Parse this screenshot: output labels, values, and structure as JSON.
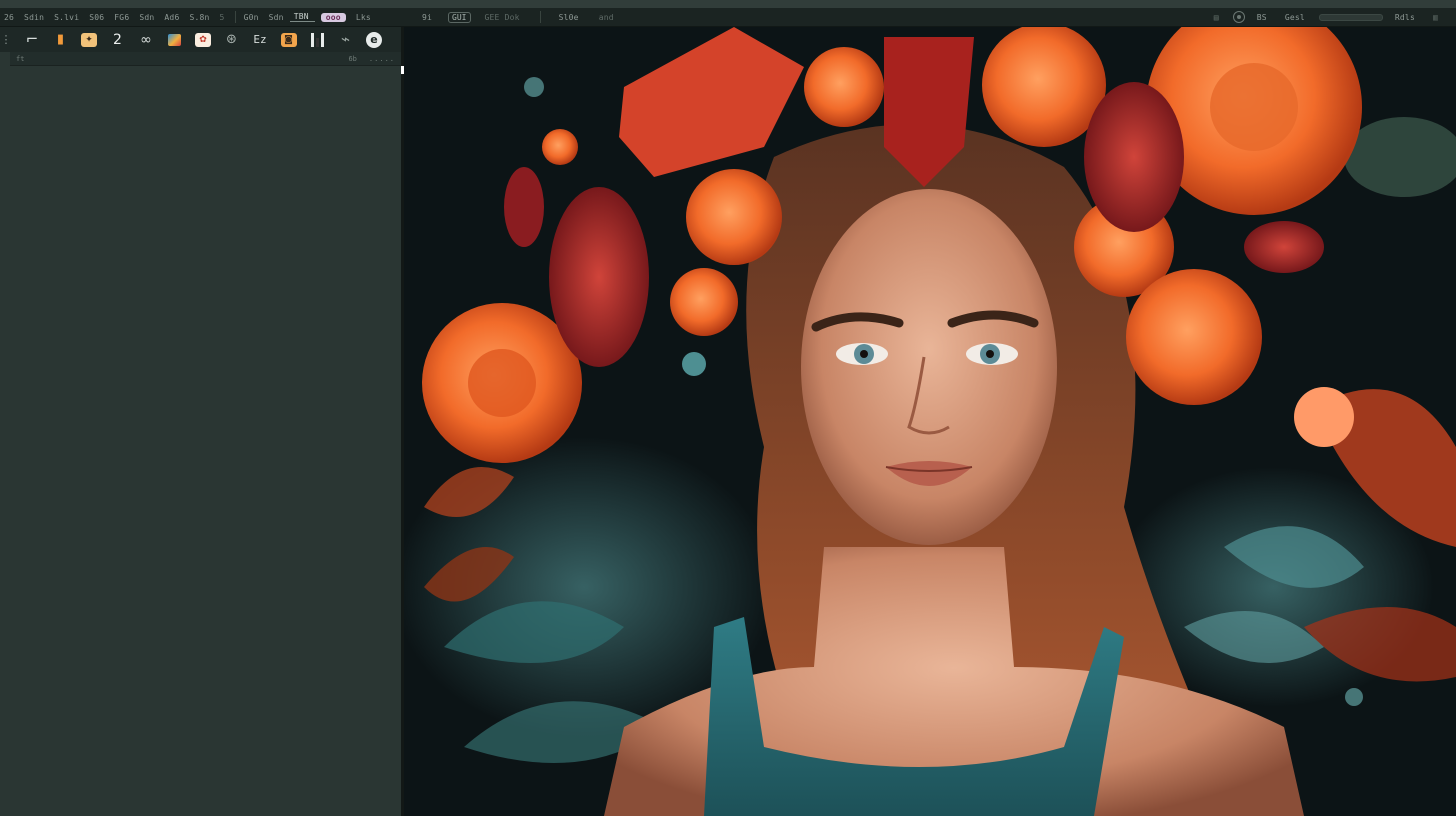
{
  "menubar": {
    "left_items": [
      {
        "label": "26"
      },
      {
        "label": "Sdin"
      },
      {
        "label": "S.lvi"
      },
      {
        "label": "S06"
      },
      {
        "label": "FG6"
      },
      {
        "label": "Sdn"
      },
      {
        "label": "Ad6"
      },
      {
        "label": "S.8n"
      },
      {
        "label": "5"
      },
      {
        "label": "G0n"
      },
      {
        "label": "Sdn"
      },
      {
        "label": "TBN"
      },
      {
        "label": "ooo"
      },
      {
        "label": "Lks"
      }
    ],
    "center_items": [
      {
        "label": "9i"
      },
      {
        "label": "GUI"
      },
      {
        "label": "GEE Dok"
      },
      {
        "label": "Sl0e"
      },
      {
        "label": "and"
      }
    ],
    "right_items": [
      {
        "label": "BS"
      },
      {
        "label": "Gesl"
      },
      {
        "label": "Rdls"
      }
    ]
  },
  "toolbar": {
    "tools": [
      {
        "name": "tool-handle",
        "glyph": "⋮"
      },
      {
        "name": "tool-crop",
        "glyph": "⌐"
      },
      {
        "name": "tool-marker",
        "glyph": "▮"
      },
      {
        "name": "tool-stamp",
        "glyph": "✦"
      },
      {
        "name": "tool-number",
        "glyph": "2"
      },
      {
        "name": "tool-link",
        "glyph": "∞"
      },
      {
        "name": "tool-image",
        "glyph": ""
      },
      {
        "name": "tool-sticker",
        "glyph": "✿"
      },
      {
        "name": "tool-swirl",
        "glyph": "⊛"
      },
      {
        "name": "tool-text",
        "glyph": "Ez"
      },
      {
        "name": "tool-bag",
        "glyph": "◙"
      },
      {
        "name": "tool-bars",
        "glyph": ""
      },
      {
        "name": "tool-brush",
        "glyph": "⌁"
      },
      {
        "name": "tool-circle",
        "glyph": "e"
      }
    ]
  },
  "subbar": {
    "left": "ft",
    "mid": "6b",
    "right": "....."
  },
  "colors": {
    "panel": "#2a3633",
    "menubar": "#1b2422",
    "canvas_bg": "#0d1416",
    "accent_orange": "#f26b2a",
    "accent_teal": "#4e8f92"
  }
}
